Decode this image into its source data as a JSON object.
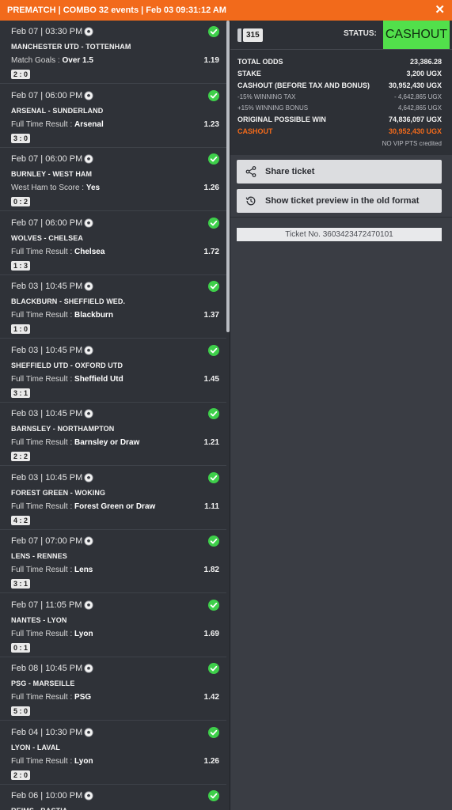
{
  "header": {
    "title": "PREMATCH | COMBO 32 events | Feb 03 09:31:12 AM",
    "close_label": "✕"
  },
  "events": [
    {
      "datetime": "Feb 07 | 03:30 PM",
      "teams": "MANCHESTER UTD - TOTTENHAM",
      "market": "Match Goals",
      "selection": "Over 1.5",
      "odd": "1.19",
      "score": "2 : 0"
    },
    {
      "datetime": "Feb 07 | 06:00 PM",
      "teams": "ARSENAL - SUNDERLAND",
      "market": "Full Time Result",
      "selection": "Arsenal",
      "odd": "1.23",
      "score": "3 : 0"
    },
    {
      "datetime": "Feb 07 | 06:00 PM",
      "teams": "BURNLEY - WEST HAM",
      "market": "West Ham to Score",
      "selection": "Yes",
      "odd": "1.26",
      "score": "0 : 2"
    },
    {
      "datetime": "Feb 07 | 06:00 PM",
      "teams": "WOLVES - CHELSEA",
      "market": "Full Time Result",
      "selection": "Chelsea",
      "odd": "1.72",
      "score": "1 : 3"
    },
    {
      "datetime": "Feb 03 | 10:45 PM",
      "teams": "BLACKBURN - SHEFFIELD WED.",
      "market": "Full Time Result",
      "selection": "Blackburn",
      "odd": "1.37",
      "score": "1 : 0"
    },
    {
      "datetime": "Feb 03 | 10:45 PM",
      "teams": "SHEFFIELD UTD - OXFORD UTD",
      "market": "Full Time Result",
      "selection": "Sheffield Utd",
      "odd": "1.45",
      "score": "3 : 1"
    },
    {
      "datetime": "Feb 03 | 10:45 PM",
      "teams": "BARNSLEY - NORTHAMPTON",
      "market": "Full Time Result",
      "selection": "Barnsley or Draw",
      "odd": "1.21",
      "score": "2 : 2"
    },
    {
      "datetime": "Feb 03 | 10:45 PM",
      "teams": "FOREST GREEN - WOKING",
      "market": "Full Time Result",
      "selection": "Forest Green or Draw",
      "odd": "1.11",
      "score": "4 : 2"
    },
    {
      "datetime": "Feb 07 | 07:00 PM",
      "teams": "LENS - RENNES",
      "market": "Full Time Result",
      "selection": "Lens",
      "odd": "1.82",
      "score": "3 : 1"
    },
    {
      "datetime": "Feb 07 | 11:05 PM",
      "teams": "NANTES - LYON",
      "market": "Full Time Result",
      "selection": "Lyon",
      "odd": "1.69",
      "score": "0 : 1"
    },
    {
      "datetime": "Feb 08 | 10:45 PM",
      "teams": "PSG - MARSEILLE",
      "market": "Full Time Result",
      "selection": "PSG",
      "odd": "1.42",
      "score": "5 : 0"
    },
    {
      "datetime": "Feb 04 | 10:30 PM",
      "teams": "LYON - LAVAL",
      "market": "Full Time Result",
      "selection": "Lyon",
      "odd": "1.26",
      "score": "2 : 0"
    },
    {
      "datetime": "Feb 06 | 10:00 PM",
      "teams": "REIMS - BASTIA",
      "market": "",
      "selection": "",
      "odd": "",
      "score": ""
    }
  ],
  "ticket": {
    "count": "315",
    "status_label": "STATUS:",
    "status_value": "CASHOUT",
    "status_color": "#52e04b"
  },
  "summary": {
    "total_odds_label": "TOTAL ODDS",
    "total_odds": "23,386.28",
    "stake_label": "STAKE",
    "stake": "3,200 UGX",
    "cashout_before_label": "CASHOUT (BEFORE TAX AND BONUS)",
    "cashout_before": "30,952,430 UGX",
    "tax_label": "-15% WINNING TAX",
    "tax": "- 4,642,865 UGX",
    "bonus_label": "+15% WINNING BONUS",
    "bonus": "4,642,865 UGX",
    "possible_win_label": "ORIGINAL POSSIBLE WIN",
    "possible_win": "74,836,097 UGX",
    "cashout_label": "CASHOUT",
    "cashout": "30,952,430 UGX",
    "vip_note": "NO VIP PTS credited"
  },
  "actions": {
    "share_label": "Share ticket",
    "old_preview_label": "Show ticket preview in the old format"
  },
  "ticket_number": "Ticket No. 3603423472470101",
  "colors": {
    "accent": "#f26a1b",
    "win_check": "#3ecf4a",
    "cashout_green": "#52e04b"
  }
}
